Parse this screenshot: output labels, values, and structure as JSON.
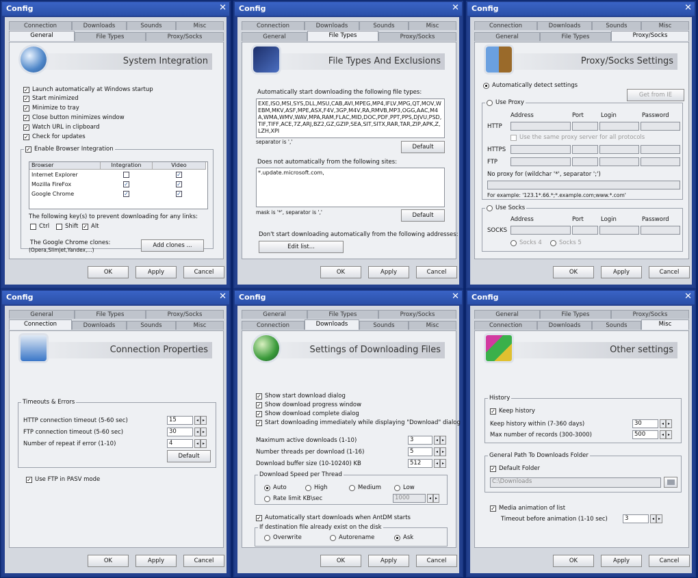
{
  "common": {
    "title": "Config",
    "close": "✕",
    "ok": "OK",
    "apply": "Apply",
    "cancel": "Cancel",
    "default": "Default",
    "tabs": [
      "Connection",
      "Downloads",
      "Sounds",
      "Misc",
      "General",
      "File Types",
      "Proxy/Socks"
    ]
  },
  "general": {
    "header": "System Integration",
    "checks": [
      "Launch automatically at Windows startup",
      "Start minimized",
      "Minimize to tray",
      "Close button minimizes window",
      "Watch URL in clipboard",
      "Check for updates"
    ],
    "browser_group": "Enable Browser Integration",
    "table": {
      "headers": [
        "Browser",
        "Integration",
        "Video"
      ],
      "rows": [
        {
          "name": "Internet Explorer",
          "integration": false,
          "video": true
        },
        {
          "name": "Mozilla FireFox",
          "integration": true,
          "video": true
        },
        {
          "name": "Google Chrome",
          "integration": true,
          "video": true
        }
      ]
    },
    "keys_label": "The following key(s) to prevent downloading for any links:",
    "keys": [
      {
        "label": "Ctrl",
        "checked": false
      },
      {
        "label": "Shift",
        "checked": false
      },
      {
        "label": "Alt",
        "checked": true
      }
    ],
    "clones_label": "The Google Chrome clones:",
    "clones_sub": "(Opera,Slimjet,Yandex,...)",
    "add_clones": "Add clones ..."
  },
  "filetypes": {
    "header": "File Types And Exclusions",
    "auto_label": "Automatically start downloading the following file types:",
    "types": "EXE,ISO,MSI,SYS,DLL,MSU,CAB,AVI,MPEG,MP4,IFLV,MPG,QT,MOV,WEBM,MKV,ASF,MPE,ASX,F4V,3GP,M4V,RA,RMVB,MP3,OGG,AAC,M4A,WMA,WMV,WAV,MPA,RAM,FLAC,MID,DOC,PDF,PPT,PPS,DJVU,PSD,TIF,TIFF,ACE,7Z,ARJ,BZ2,GZ,GZIP,SEA,SIT,SITX,RAR,TAR,ZIP,APK,Z,LZH,XPI",
    "sep1": "separator is ','",
    "sites_label": "Does not automatically from the following sites:",
    "sites": "*.update.microsoft.com,",
    "sep2": "mask is '*', separator is ','",
    "addr_label": "Don't start downloading automatically from the following addresses:",
    "edit": "Edit list..."
  },
  "proxy": {
    "header": "Proxy/Socks Settings",
    "auto": "Automatically detect settings",
    "getie": "Get from IE",
    "use_proxy": "Use Proxy",
    "cols": [
      "Address",
      "Port",
      "Login",
      "Password"
    ],
    "http": "HTTP",
    "same": "Use the same proxy server for all protocols",
    "https": "HTTPS",
    "ftp": "FTP",
    "noproxy": "No proxy for (wildchar '*', separator ';')",
    "example": "For example: '123.1*.66.*;*.example.com;www.*.com'",
    "use_socks": "Use Socks",
    "socks": "SOCKS",
    "socks4": "Socks 4",
    "socks5": "Socks 5"
  },
  "connection": {
    "header": "Connection Properties",
    "group": "Timeouts & Errors",
    "rows": [
      {
        "label": "HTTP connection timeout (5-60 sec)",
        "value": "15"
      },
      {
        "label": "FTP connection timeout (5-60 sec)",
        "value": "30"
      },
      {
        "label": "Number of repeat if error (1-10)",
        "value": "4"
      }
    ],
    "pasv": "Use FTP in PASV mode"
  },
  "downloads": {
    "header": "Settings of Downloading Files",
    "checks": [
      "Show start download dialog",
      "Show download progress window",
      "Show download complete dialog",
      "Start downloading immediately while displaying \"Download\" dialog"
    ],
    "rows": [
      {
        "label": "Maximum active downloads (1-10)",
        "value": "3"
      },
      {
        "label": "Number threads per download (1-16)",
        "value": "5"
      },
      {
        "label": "Download buffer size (10-10240) KB",
        "value": "512"
      }
    ],
    "speed_group": "Download Speed per Thread",
    "speeds": [
      "Auto",
      "High",
      "Medium",
      "Low"
    ],
    "rate": "Rate limit KB\\sec",
    "rate_val": "1000",
    "auto_start": "Automatically start downloads when AntDM starts",
    "exist_group": "If destination file already exist on the disk",
    "exist": [
      "Overwrite",
      "Autorename",
      "Ask"
    ]
  },
  "misc": {
    "header": "Other settings",
    "history_group": "History",
    "keep": "Keep history",
    "rows": [
      {
        "label": "Keep history within (7-360 days)",
        "value": "30"
      },
      {
        "label": "Max number of records (300-3000)",
        "value": "500"
      }
    ],
    "path_group": "General Path To Downloads Folder",
    "default_folder": "Default Folder",
    "path": "C:\\Downloads",
    "media": "Media animation of list",
    "timeout": "Timeout before animation (1-10 sec)",
    "timeout_val": "3"
  }
}
